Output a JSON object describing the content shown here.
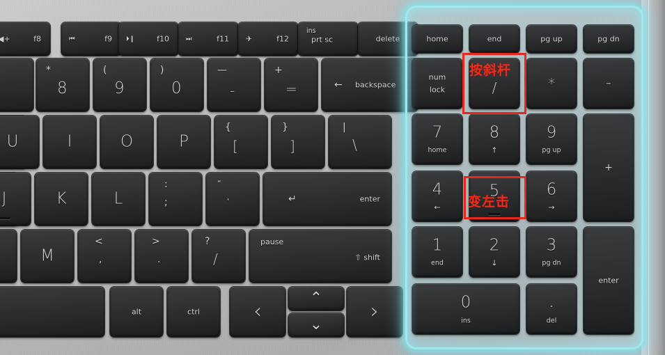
{
  "scene": {
    "subject": "laptop-keyboard-right-side",
    "description": "HP laptop keyboard close-up with numeric keypad highlighted by a cyan glow and two red annotations",
    "colors": {
      "keycap": "#2b2c2e",
      "keycap_text": "#cfd1d2",
      "chassis": "#b9bbbd",
      "glow_cyan": "#9fe8ef",
      "annotation_red": "#e8261c"
    }
  },
  "annotations": [
    {
      "id": "slash-annotation",
      "text": "按斜杆",
      "target_key": "/",
      "color": "#ee2a18"
    },
    {
      "id": "five-annotation",
      "text": "变左击",
      "target_key": "5",
      "color": "#ee2a18"
    }
  ],
  "function_row": [
    {
      "icon": "volume-up-icon",
      "glyph": "◀+",
      "label": "f8"
    },
    {
      "icon": "prev-track-icon",
      "glyph": "⏮",
      "label": "f9"
    },
    {
      "icon": "play-pause-icon",
      "glyph": "⏵❙",
      "label": "f10"
    },
    {
      "icon": "next-track-icon",
      "glyph": "⏭",
      "label": "f11"
    },
    {
      "icon": "airplane-mode-icon",
      "glyph": "✈",
      "label": "f12"
    },
    {
      "icon": "print-screen-icon",
      "glyph": "",
      "label": "prt sc",
      "sublabel": "ins"
    },
    {
      "icon": "delete-icon",
      "glyph": "",
      "label": "delete"
    }
  ],
  "number_row": [
    {
      "shift": "*",
      "base": "8"
    },
    {
      "shift": "(",
      "base": "9"
    },
    {
      "shift": ")",
      "base": "0"
    },
    {
      "shift": "—",
      "base": "-"
    },
    {
      "shift": "+",
      "base": "="
    },
    {
      "glyph": "←",
      "label": "backspace"
    }
  ],
  "qwerty_row": [
    {
      "base": "U"
    },
    {
      "base": "I"
    },
    {
      "base": "O"
    },
    {
      "base": "P"
    },
    {
      "shift": "{",
      "base": "["
    },
    {
      "shift": "}",
      "base": "]"
    },
    {
      "shift": "|",
      "base": "\\"
    }
  ],
  "home_row": [
    {
      "base": "J",
      "bump": true
    },
    {
      "base": "K"
    },
    {
      "base": "L"
    },
    {
      "shift": ":",
      "base": ";"
    },
    {
      "shift": "“",
      "base": "'"
    },
    {
      "glyph": "↵",
      "label": "enter"
    }
  ],
  "bottom_letter_row": [
    {
      "base": "M"
    },
    {
      "shift": "<",
      "base": ","
    },
    {
      "shift": ">",
      "base": "."
    },
    {
      "shift": "?",
      "base": "/"
    },
    {
      "label": "pause",
      "shift_label": "⇧ shift"
    }
  ],
  "modifier_row": [
    {
      "label": "",
      "name": "spacebar"
    },
    {
      "label": "alt"
    },
    {
      "label": "ctrl"
    },
    {
      "glyph": "‹",
      "name": "arrow-left"
    },
    {
      "glyph": "⌃",
      "name": "arrow-up"
    },
    {
      "glyph": "⌄",
      "name": "arrow-down"
    },
    {
      "glyph": "›",
      "name": "arrow-right"
    }
  ],
  "numpad": {
    "row1": [
      {
        "label": "home"
      },
      {
        "label": "end"
      },
      {
        "label": "pg up"
      },
      {
        "label": "pg dn"
      }
    ],
    "row2": [
      {
        "label": "num",
        "label2": "lock"
      },
      {
        "base": "/",
        "annotated": true
      },
      {
        "base": "*"
      },
      {
        "base": "–"
      }
    ],
    "row3": [
      {
        "base": "7",
        "sub": "home"
      },
      {
        "base": "8",
        "sub": "↑"
      },
      {
        "base": "9",
        "sub": "pg up"
      },
      {
        "base": "+",
        "tall": true
      }
    ],
    "row4": [
      {
        "base": "4",
        "sub": "←"
      },
      {
        "base": "5",
        "bump": true,
        "annotated": true
      },
      {
        "base": "6",
        "sub": "→"
      }
    ],
    "row5": [
      {
        "base": "1",
        "sub": "end"
      },
      {
        "base": "2",
        "sub": "↓"
      },
      {
        "base": "3",
        "sub": "pg dn"
      },
      {
        "label": "enter",
        "tall": true
      }
    ],
    "row6": [
      {
        "base": "0",
        "sub": "ins",
        "wide": true
      },
      {
        "base": ".",
        "sub": "del"
      }
    ]
  }
}
